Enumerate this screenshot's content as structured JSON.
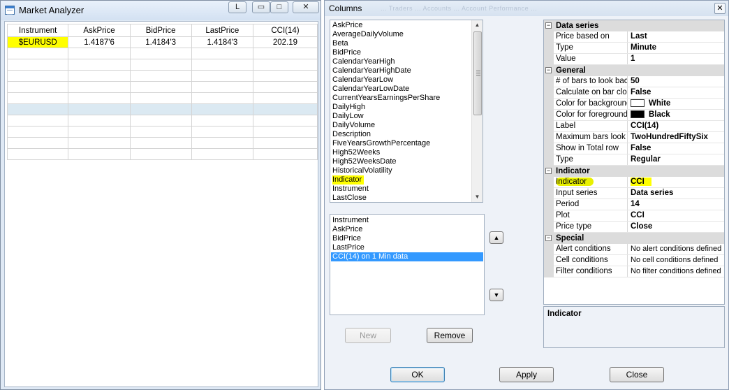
{
  "market_analyzer": {
    "title": "Market Analyzer",
    "link_button": "L",
    "columns": [
      "Instrument",
      "AskPrice",
      "BidPrice",
      "LastPrice",
      "CCI(14)"
    ],
    "rows": [
      {
        "instrument": "$EURUSD",
        "ask": "1.4187'6",
        "bid": "1.4184'3",
        "last": "1.4184'3",
        "cci": "202.19"
      }
    ],
    "highlight_color": "#ffff00"
  },
  "columns_dialog": {
    "title": "Columns",
    "ghost_title": "... Traders ... Accounts ... Account Performance ...",
    "available": [
      "AskPrice",
      "AverageDailyVolume",
      "Beta",
      "BidPrice",
      "CalendarYearHigh",
      "CalendarYearHighDate",
      "CalendarYearLow",
      "CalendarYearLowDate",
      "CurrentYearsEarningsPerShare",
      "DailyHigh",
      "DailyLow",
      "DailyVolume",
      "Description",
      "FiveYearsGrowthPercentage",
      "High52Weeks",
      "High52WeeksDate",
      "HistoricalVolatility",
      "Indicator",
      "Instrument",
      "LastClose"
    ],
    "available_highlighted": "Indicator",
    "selected": [
      "Instrument",
      "AskPrice",
      "BidPrice",
      "LastPrice",
      "CCI(14) on 1 Min data"
    ],
    "selected_active": "CCI(14) on 1 Min data",
    "buttons": {
      "new": "New",
      "remove": "Remove",
      "ok": "OK",
      "apply": "Apply",
      "close": "Close"
    },
    "properties": {
      "data_series": {
        "label": "Data series",
        "rows": [
          {
            "name": "Price based on",
            "value": "Last"
          },
          {
            "name": "Type",
            "value": "Minute"
          },
          {
            "name": "Value",
            "value": "1"
          }
        ]
      },
      "general": {
        "label": "General",
        "rows": [
          {
            "name": "# of bars to look back",
            "value": "50"
          },
          {
            "name": "Calculate on bar close",
            "value": "False"
          },
          {
            "name": "Color for background",
            "value": "White",
            "swatch": "#ffffff"
          },
          {
            "name": "Color for foreground",
            "value": "Black",
            "swatch": "#000000"
          },
          {
            "name": "Label",
            "value": "CCI(14)"
          },
          {
            "name": "Maximum bars look back",
            "value": "TwoHundredFiftySix"
          },
          {
            "name": "Show in Total row",
            "value": "False"
          },
          {
            "name": "Type",
            "value": "Regular"
          }
        ]
      },
      "indicator": {
        "label": "Indicator",
        "rows": [
          {
            "name": "Indicator",
            "value": "CCI"
          },
          {
            "name": "Input series",
            "value": "Data series"
          },
          {
            "name": "Period",
            "value": "14"
          },
          {
            "name": "Plot",
            "value": "CCI"
          },
          {
            "name": "Price type",
            "value": "Close"
          }
        ]
      },
      "special": {
        "label": "Special",
        "rows": [
          {
            "name": "Alert conditions",
            "value": "No alert conditions defined"
          },
          {
            "name": "Cell conditions",
            "value": "No cell conditions defined"
          },
          {
            "name": "Filter conditions",
            "value": "No filter conditions defined"
          }
        ]
      }
    },
    "description_title": "Indicator"
  }
}
